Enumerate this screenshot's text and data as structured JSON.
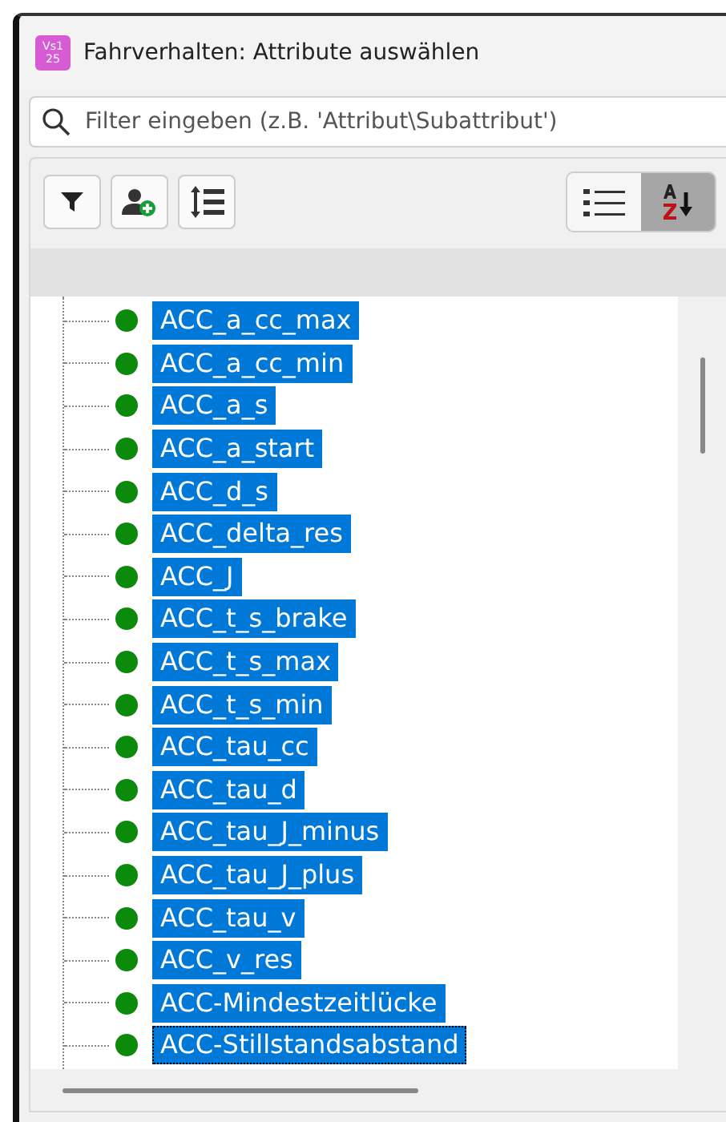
{
  "window": {
    "title": "Fahrverhalten: Attribute auswählen",
    "icon_text": "Vs1\n25"
  },
  "filter": {
    "placeholder": "Filter eingeben (z.B. 'Attribut\\Subattribut')"
  },
  "toolbar": {
    "left_buttons": [
      {
        "kind": "filter"
      },
      {
        "kind": "add-user"
      },
      {
        "kind": "expand"
      }
    ],
    "view_toggle": [
      {
        "kind": "list",
        "selected": false
      },
      {
        "kind": "sort",
        "selected": true
      }
    ]
  },
  "items": [
    {
      "label": "ACC_a_cc_max",
      "selected": true,
      "focused": false
    },
    {
      "label": "ACC_a_cc_min",
      "selected": true,
      "focused": false
    },
    {
      "label": "ACC_a_s",
      "selected": true,
      "focused": false
    },
    {
      "label": "ACC_a_start",
      "selected": true,
      "focused": false
    },
    {
      "label": "ACC_d_s",
      "selected": true,
      "focused": false
    },
    {
      "label": "ACC_delta_res",
      "selected": true,
      "focused": false
    },
    {
      "label": "ACC_J",
      "selected": true,
      "focused": false
    },
    {
      "label": "ACC_t_s_brake",
      "selected": true,
      "focused": false
    },
    {
      "label": "ACC_t_s_max",
      "selected": true,
      "focused": false
    },
    {
      "label": "ACC_t_s_min",
      "selected": true,
      "focused": false
    },
    {
      "label": "ACC_tau_cc",
      "selected": true,
      "focused": false
    },
    {
      "label": "ACC_tau_d",
      "selected": true,
      "focused": false
    },
    {
      "label": "ACC_tau_J_minus",
      "selected": true,
      "focused": false
    },
    {
      "label": "ACC_tau_J_plus",
      "selected": true,
      "focused": false
    },
    {
      "label": "ACC_tau_v",
      "selected": true,
      "focused": false
    },
    {
      "label": "ACC_v_res",
      "selected": true,
      "focused": false
    },
    {
      "label": "ACC-Mindestzeitlücke",
      "selected": true,
      "focused": false
    },
    {
      "label": "ACC-Stillstandsabstand",
      "selected": true,
      "focused": true
    }
  ]
}
